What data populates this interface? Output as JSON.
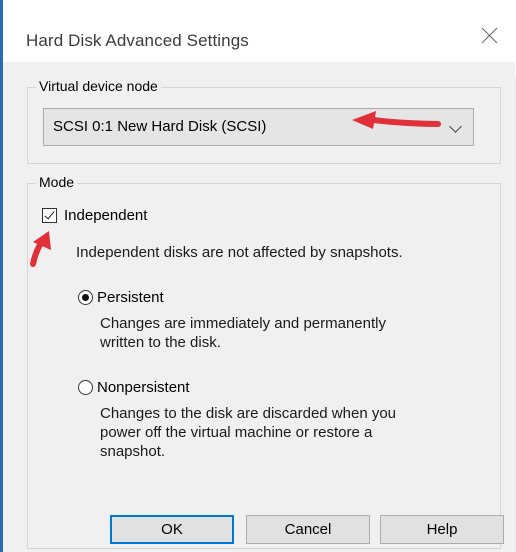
{
  "dialog": {
    "title": "Hard Disk Advanced Settings"
  },
  "virtual_device_node": {
    "legend": "Virtual device node",
    "selected": "SCSI 0:1  New Hard Disk (SCSI)"
  },
  "mode": {
    "legend": "Mode",
    "independent_label": "Independent",
    "independent_checked": true,
    "independent_desc": "Independent disks are not affected by snapshots.",
    "persistent": {
      "label": "Persistent",
      "selected": true,
      "desc": [
        "Changes are immediately and permanently",
        "written to the disk."
      ]
    },
    "nonpersistent": {
      "label": "Nonpersistent",
      "selected": false,
      "desc": [
        "Changes to the disk are discarded when you",
        "power off the virtual machine or restore a",
        "snapshot."
      ]
    }
  },
  "buttons": {
    "ok": "OK",
    "cancel": "Cancel",
    "help": "Help"
  },
  "annotation_color": "#e0303a"
}
